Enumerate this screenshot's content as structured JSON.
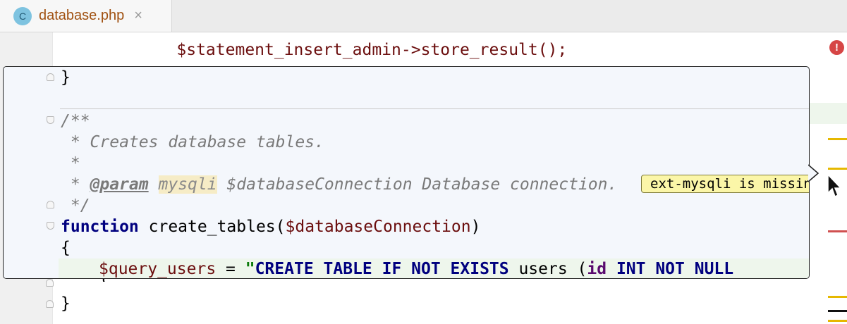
{
  "tab": {
    "icon_letter": "C",
    "label": "database.php",
    "close": "×"
  },
  "code": {
    "line_before": "    $statement_insert_admin->store_result();",
    "popup": {
      "l1": "}",
      "l3_start": "/**",
      "l4": " * Creates database tables.",
      "l5": " *",
      "l6_star": " * ",
      "l6_tag": "@param",
      "l6_type": "mysqli",
      "l6_rest": " $databaseConnection Database connection.",
      "l7": " */",
      "l8_kw": "function",
      "l8_name": " create_tables(",
      "l8_var": "$databaseConnection",
      "l8_close": ")",
      "l9": "{",
      "l10_var": "$query_users",
      "l10_eq": " = ",
      "l10_q": "\"",
      "l10_sql1": "CREATE TABLE IF NOT EXISTS",
      "l10_tbl": " users (",
      "l10_id": "id",
      "l10_sql2": " INT NOT NULL"
    },
    "after_brace1": "}",
    "after_brace2": "}",
    "tooltip": "ext-mysqli is missing"
  },
  "markers": {
    "error_glyph": "!"
  },
  "colors": {
    "marker_yellow": "#e6b800",
    "marker_red": "#d05050",
    "marker_black": "#111111",
    "marker_green": "#d6ecd2"
  }
}
